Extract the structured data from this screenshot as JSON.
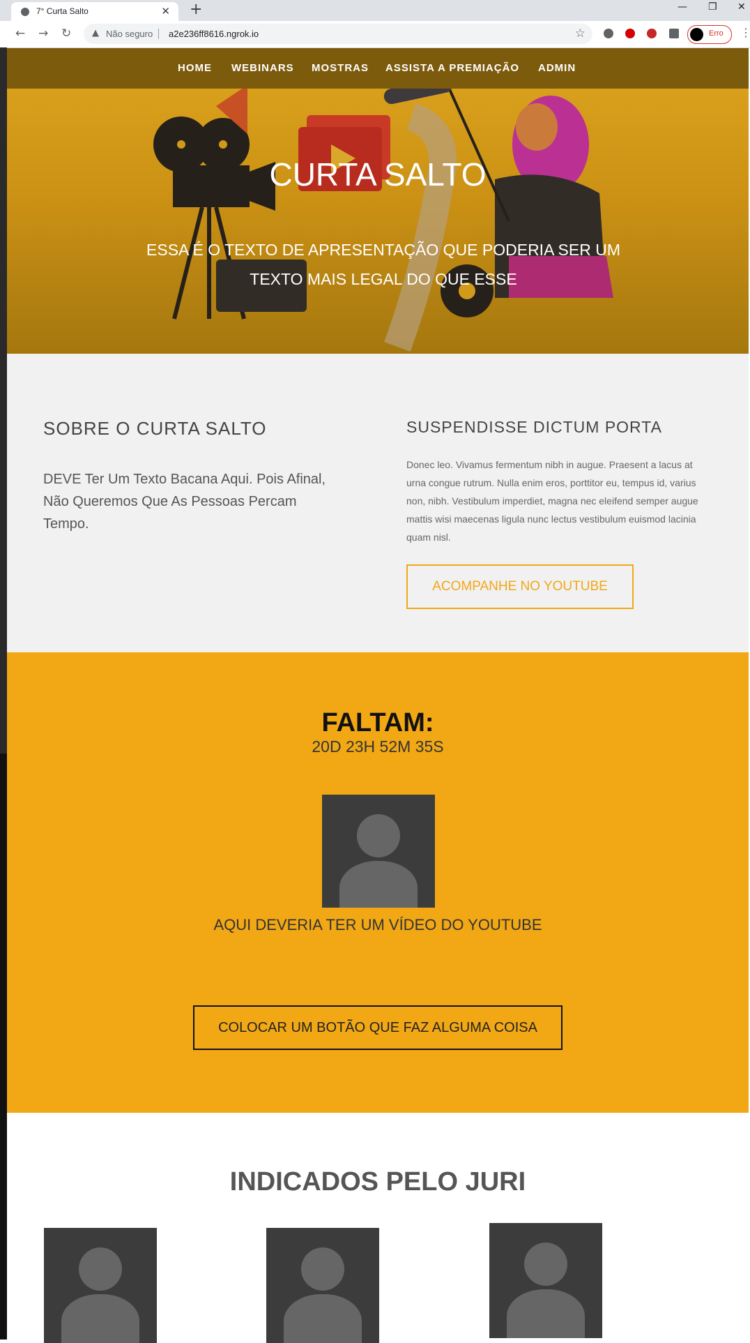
{
  "browser": {
    "tab_title": "7° Curta Salto",
    "security_label": "Não seguro",
    "url": "a2e236ff8616.ngrok.io",
    "profile_label": "Erro"
  },
  "nav": {
    "items": [
      {
        "label": "HOME"
      },
      {
        "label": "WEBINARS"
      },
      {
        "label": "MOSTRAS"
      },
      {
        "label": "ASSISTA A PREMIAÇÃO"
      },
      {
        "label": "ADMIN"
      }
    ]
  },
  "hero": {
    "title": "CURTA SALTO",
    "text": "ESSA É O TEXTO DE APRESENTAÇÃO QUE PODERIA SER UM TEXTO MAIS LEGAL DO QUE ESSE"
  },
  "about": {
    "title": "SOBRE O CURTA SALTO",
    "text": "DEVE Ter Um Texto Bacana Aqui. Pois Afinal, Não Queremos Que As Pessoas Percam Tempo.",
    "side_title": "SUSPENDISSE DICTUM PORTA",
    "side_text": "Donec leo. Vivamus fermentum nibh in augue. Praesent a lacus at urna congue rutrum. Nulla enim eros, porttitor eu, tempus id, varius non, nibh. Vestibulum imperdiet, magna nec eleifend semper augue mattis wisi maecenas ligula nunc lectus vestibulum euismod lacinia quam nisl.",
    "youtube_button": "ACOMPANHE NO YOUTUBE"
  },
  "countdown": {
    "label": "FALTAM:",
    "value": "20D 23H 52M 35S",
    "video_caption": "AQUI DEVERIA TER UM VÍDEO DO YOUTUBE",
    "action_button": "COLOCAR UM BOTÃO QUE FAZ ALGUMA COISA"
  },
  "indicados": {
    "title": "INDICADOS PELO JURI"
  },
  "colors": {
    "nav_bg": "#7d5b0d",
    "accent": "#f2a815",
    "about_bg": "#f1f1f1"
  }
}
